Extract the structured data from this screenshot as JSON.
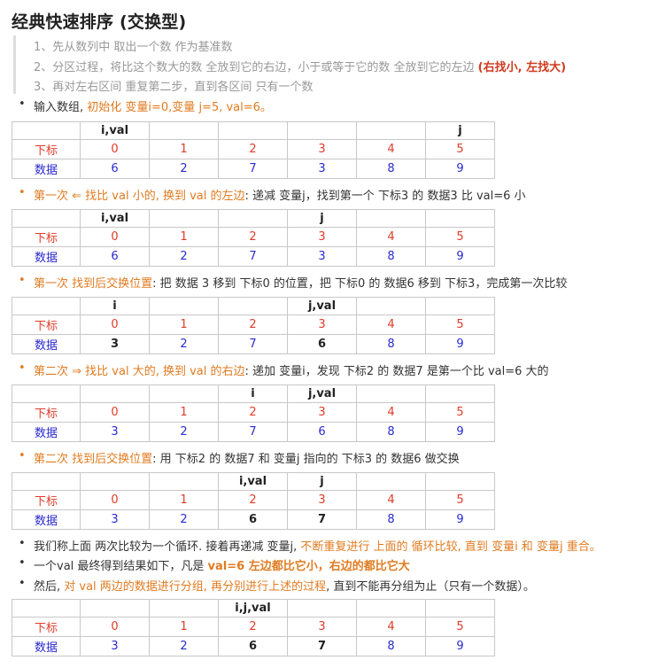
{
  "title": "经典快速排序 (交换型)",
  "steps": [
    "1、先从数列中 取出一个数 作为基准数",
    "2、分区过程，将比这个数大的数 全放到它的右边，小于或等于它的数 全放到它的左边 ",
    "3、再对左右区间 重复第二步，直到各区间 只有一个数"
  ],
  "step2_highlight": "(右找小, 左找大)",
  "colors": {
    "orange": "#e07b20",
    "red": "#d03a1e",
    "index": "#e03c28",
    "data": "#2a2ad0"
  },
  "row_labels": {
    "index": "下标",
    "data": "数据"
  },
  "indices": [
    "0",
    "1",
    "2",
    "3",
    "4",
    "5"
  ],
  "b1": {
    "a": "输入数组, ",
    "b": "初始化 变量i=0,变量 j=5, val=6。"
  },
  "b2": {
    "a": "第一次 ⇐ 找比 val 小的, 换到 val 的左边",
    "b": ": 递减 变量j，找到第一个 下标3 的 数据3 比 val=6 小"
  },
  "b3": {
    "a": "第一次 找到后交换位置",
    "b": ": 把 数据 3 移到 下标0 的位置，把 下标0 的 数据6 移到 下标3，完成第一次比较"
  },
  "b4": {
    "a": "第二次 ⇒ 找比 val 大的, 换到 val 的右边",
    "b": ": 递加 变量i，发现 下标2 的 数据7 是第一个比 val=6 大的"
  },
  "b5": {
    "a": "第二次 找到后交换位置",
    "b": ": 用 下标2 的 数据7 和 变量j 指向的 下标3 的 数据6 做交换"
  },
  "b6": {
    "a": "我们称上面 两次比较为一个循环. 接着再递减 变量j, ",
    "b": "不断重复进行 上面的 循环比较, 直到 变量i 和 变量j 重合。"
  },
  "b7": {
    "a": "一个val 最终得到结果如下，凡是 ",
    "b": "val=6 左边都比它小，右边的都比它大"
  },
  "b8": {
    "a": "然后, ",
    "b": "对 val 两边的数据进行分组, 再分别进行上述的过程",
    "c": ", 直到不能再分组为止（只有一个数据）。"
  },
  "tables": [
    {
      "headers": [
        "i,val",
        "",
        "",
        "",
        "",
        "j"
      ],
      "data": [
        "6",
        "2",
        "7",
        "3",
        "8",
        "9"
      ]
    },
    {
      "headers": [
        "i,val",
        "",
        "",
        "j",
        "",
        ""
      ],
      "data": [
        "6",
        "2",
        "7",
        "3",
        "8",
        "9"
      ]
    },
    {
      "headers": [
        "i",
        "",
        "",
        "j,val",
        "",
        ""
      ],
      "data": [
        "3",
        "2",
        "7",
        "6",
        "8",
        "9"
      ]
    },
    {
      "headers": [
        "",
        "",
        "i",
        "j,val",
        "",
        ""
      ],
      "data": [
        "3",
        "2",
        "7",
        "6",
        "8",
        "9"
      ]
    },
    {
      "headers": [
        "",
        "",
        "i,val",
        "j",
        "",
        ""
      ],
      "data": [
        "3",
        "2",
        "6",
        "7",
        "8",
        "9"
      ]
    },
    {
      "headers": [
        "",
        "",
        "i,j,val",
        "",
        "",
        ""
      ],
      "data": [
        "3",
        "2",
        "6",
        "7",
        "8",
        "9"
      ]
    }
  ]
}
